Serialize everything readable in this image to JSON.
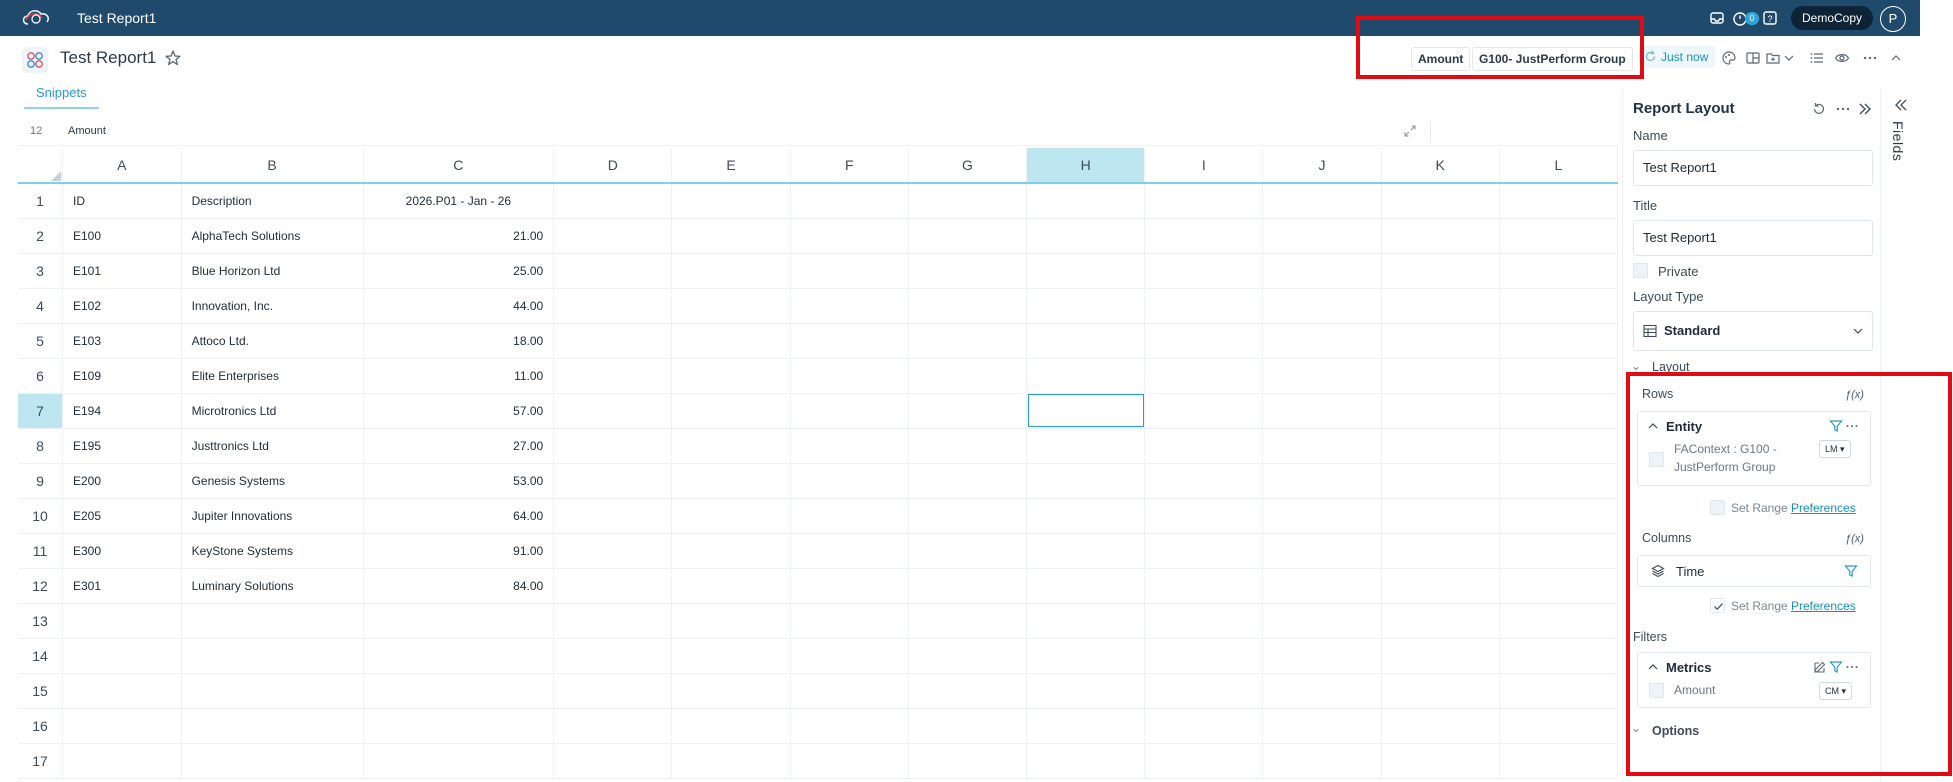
{
  "topbar": {
    "app_title": "Test Report1",
    "notification_count": "0",
    "tenant": "DemoCopy",
    "avatar_initial": "P"
  },
  "header": {
    "title": "Test Report1",
    "chips": [
      "Amount",
      "G100- JustPerform Group"
    ],
    "refresh_label": "Just now"
  },
  "tabs": {
    "snippets": "Snippets"
  },
  "formula_bar": {
    "row_number": "12",
    "value": "Amount"
  },
  "grid": {
    "columns": [
      "A",
      "B",
      "C",
      "D",
      "E",
      "F",
      "G",
      "H",
      "I",
      "J",
      "K",
      "L"
    ],
    "selected_column": "H",
    "selected_row": "7",
    "rows": [
      {
        "n": "1",
        "a": "ID",
        "b": "Description",
        "c": "2026.P01 - Jan - 26"
      },
      {
        "n": "2",
        "a": "E100",
        "b": "AlphaTech Solutions",
        "c": "21.00"
      },
      {
        "n": "3",
        "a": "E101",
        "b": "Blue Horizon Ltd",
        "c": "25.00"
      },
      {
        "n": "4",
        "a": "E102",
        "b": "Innovation, Inc.",
        "c": "44.00"
      },
      {
        "n": "5",
        "a": "E103",
        "b": "Attoco Ltd.",
        "c": "18.00"
      },
      {
        "n": "6",
        "a": "E109",
        "b": "Elite Enterprises",
        "c": "11.00"
      },
      {
        "n": "7",
        "a": "E194",
        "b": "Microtronics Ltd",
        "c": "57.00"
      },
      {
        "n": "8",
        "a": "E195",
        "b": "Justtronics Ltd",
        "c": "27.00"
      },
      {
        "n": "9",
        "a": "E200",
        "b": "Genesis Systems",
        "c": "53.00"
      },
      {
        "n": "10",
        "a": "E205",
        "b": "Jupiter Innovations",
        "c": "64.00"
      },
      {
        "n": "11",
        "a": "E300",
        "b": "KeyStone Systems",
        "c": "91.00"
      },
      {
        "n": "12",
        "a": "E301",
        "b": "Luminary Solutions",
        "c": "84.00"
      },
      {
        "n": "13",
        "a": "",
        "b": "",
        "c": ""
      },
      {
        "n": "14",
        "a": "",
        "b": "",
        "c": ""
      },
      {
        "n": "15",
        "a": "",
        "b": "",
        "c": ""
      },
      {
        "n": "16",
        "a": "",
        "b": "",
        "c": ""
      },
      {
        "n": "17",
        "a": "",
        "b": "",
        "c": ""
      }
    ]
  },
  "panel": {
    "title": "Report Layout",
    "name_label": "Name",
    "name_value": "Test Report1",
    "title_label": "Title",
    "title_value": "Test Report1",
    "private_label": "Private",
    "layout_type_label": "Layout Type",
    "layout_type_value": "Standard",
    "layout_section": "Layout",
    "rows_label": "Rows",
    "fx_label": "ƒ(x)",
    "entity_title": "Entity",
    "entity_item": "FAContext : G100 - JustPerform Group",
    "entity_select": "LM",
    "set_range_label": "Set Range",
    "preferences_label": "Preferences",
    "columns_label": "Columns",
    "time_label": "Time",
    "filters_label": "Filters",
    "metrics_title": "Metrics",
    "amount_label": "Amount",
    "amount_select": "CM",
    "options_label": "Options",
    "fields_tab": "Fields"
  },
  "colors": {
    "topbar": "#1f4a6b",
    "accent": "#2a9bc4",
    "selection": "#bde6f0",
    "highlight": "#e30b12"
  }
}
